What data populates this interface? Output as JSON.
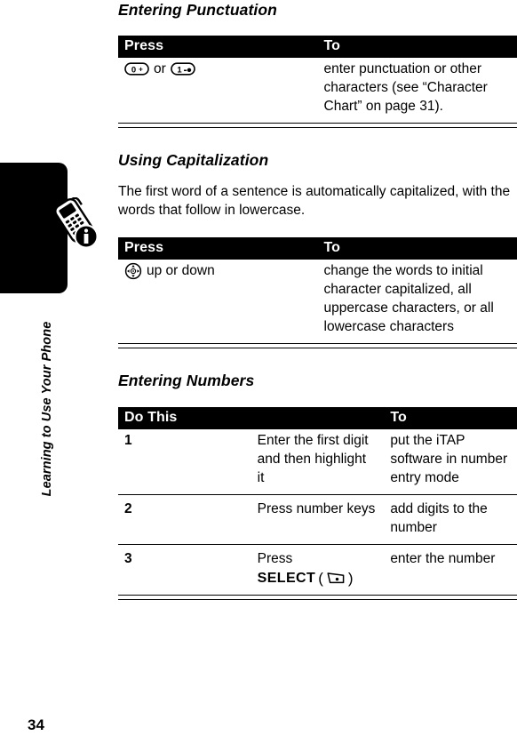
{
  "sidebar": {
    "chapter_label": "Learning to Use Your Phone",
    "page_number": "34",
    "tab_icon": "phone-info-icon"
  },
  "sections": [
    {
      "heading": "Entering Punctuation",
      "table": {
        "headers": [
          "Press",
          "To"
        ],
        "rows": [
          {
            "press_keys": [
              "0+",
              "1"
            ],
            "press_conjunction": "or",
            "to": "enter punctuation or other characters (see “Character Chart” on page 31)."
          }
        ]
      }
    },
    {
      "heading": "Using Capitalization",
      "paragraph": "The first word of a sentence is automatically capitalized, with the words that follow in lowercase.",
      "table": {
        "headers": [
          "Press",
          "To"
        ],
        "rows": [
          {
            "press_icon": "navigation-key-icon",
            "press_text": "up or down",
            "to": "change the words to initial character capitalized, all uppercase characters, or all lowercase characters"
          }
        ]
      }
    },
    {
      "heading": "Entering Numbers",
      "table": {
        "headers": [
          "Do This",
          "To"
        ],
        "rows": [
          {
            "num": "1",
            "do": "Enter the first digit and then highlight it",
            "to": "put the iTAP software in number entry mode"
          },
          {
            "num": "2",
            "do": "Press number keys",
            "to": "add digits to the number"
          },
          {
            "num": "3",
            "do_prefix": "Press",
            "do_softkey_label": "SELECT",
            "do_softkey_open": "(",
            "do_softkey_close": ")",
            "do_softkey_icon": "left-soft-key-icon",
            "to": "enter the number"
          }
        ]
      }
    }
  ],
  "colors": {
    "header_bar": "#000000",
    "header_text": "#ffffff",
    "page_background": "#ffffff",
    "rule": "#000000"
  }
}
